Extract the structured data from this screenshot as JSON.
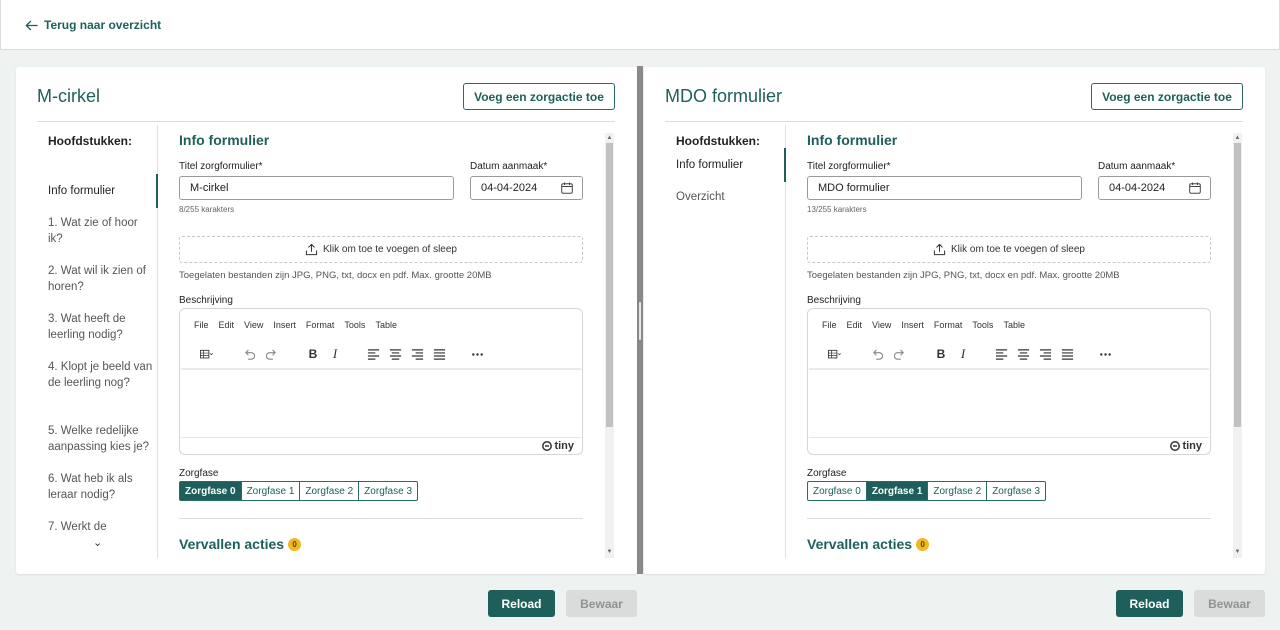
{
  "nav": {
    "back_label": "Terug naar overzicht"
  },
  "colors": {
    "accent": "#1f5f5b",
    "badge": "#f2b824",
    "disabled": "#d9dcdb"
  },
  "editor_menu": [
    "File",
    "Edit",
    "View",
    "Insert",
    "Format",
    "Tools",
    "Table"
  ],
  "editor_brand": "tiny",
  "left": {
    "title": "M-cirkel",
    "add_button": "Voeg een zorgactie toe",
    "toc_title": "Hoofdstukken:",
    "toc_items": [
      "Info formulier",
      "1. Wat zie of hoor ik?",
      "2. Wat wil ik zien of horen?",
      "3. Wat heeft de leerling nodig?",
      "4. Klopt je beeld van de leerling nog?",
      "5. Welke redelijke aanpassing kies je?",
      "6. Wat heb ik als leraar nodig?",
      "7. Werkt de"
    ],
    "toc_more": "⌄",
    "section_title": "Info formulier",
    "title_label": "Titel zorgformulier*",
    "title_value": "M-cirkel",
    "title_count": "8/255 karakters",
    "date_label": "Datum aanmaak*",
    "date_value": "04-04-2024",
    "upload_label": "Klik om toe te voegen of sleep",
    "allowed_files": "Toegelaten bestanden zijn JPG, PNG, txt, docx en pdf. Max. grootte 20MB",
    "description_label": "Beschrijving",
    "zorgfase_label": "Zorgfase",
    "zorgfases": [
      "Zorgfase 0",
      "Zorgfase 1",
      "Zorgfase 2",
      "Zorgfase 3"
    ],
    "zorgfase_selected": "Zorgfase 0",
    "vervallen_label": "Vervallen acties",
    "vervallen_count": "0",
    "reload_label": "Reload",
    "save_label": "Bewaar"
  },
  "right": {
    "title": "MDO formulier",
    "add_button": "Voeg een zorgactie toe",
    "toc_title": "Hoofdstukken:",
    "toc_items": [
      "Info formulier",
      "Overzicht"
    ],
    "section_title": "Info formulier",
    "title_label": "Titel zorgformulier*",
    "title_value": "MDO formulier",
    "title_count": "13/255 karakters",
    "date_label": "Datum aanmaak*",
    "date_value": "04-04-2024",
    "upload_label": "Klik om toe te voegen of sleep",
    "allowed_files": "Toegelaten bestanden zijn JPG, PNG, txt, docx en pdf. Max. grootte 20MB",
    "description_label": "Beschrijving",
    "zorgfase_label": "Zorgfase",
    "zorgfases": [
      "Zorgfase 0",
      "Zorgfase 1",
      "Zorgfase 2",
      "Zorgfase 3"
    ],
    "zorgfase_selected": "Zorgfase 1",
    "vervallen_label": "Vervallen acties",
    "vervallen_count": "0",
    "reload_label": "Reload",
    "save_label": "Bewaar"
  }
}
